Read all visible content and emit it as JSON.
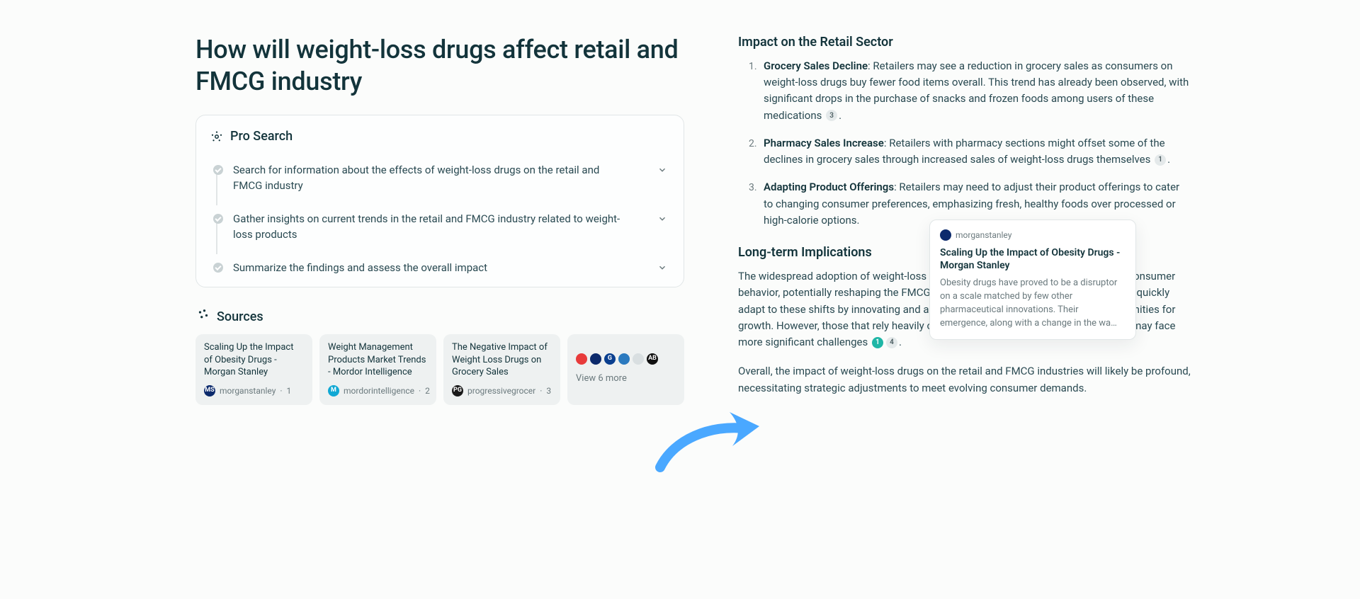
{
  "title": "How will weight-loss drugs affect retail and FMCG industry",
  "pro_search": {
    "label": "Pro Search",
    "steps": [
      {
        "text": "Search for information about the effects of weight-loss drugs on the retail and FMCG industry"
      },
      {
        "text": "Gather insights on current trends in the retail and FMCG industry related to weight-loss products"
      },
      {
        "text": "Summarize the findings and assess the overall impact"
      }
    ]
  },
  "sources": {
    "label": "Sources",
    "items": [
      {
        "title": "Scaling Up the Impact of Obesity Drugs - Morgan Stanley",
        "site": "morganstanley",
        "idx": "1",
        "fav_bg": "#0c2a6c",
        "fav_tx": "MS"
      },
      {
        "title": "Weight Management Products Market Trends - Mordor Intelligence",
        "site": "mordorintelligence",
        "idx": "2",
        "fav_bg": "#10a8d4",
        "fav_tx": "M"
      },
      {
        "title": "The Negative Impact of Weight Loss Drugs on Grocery Sales",
        "site": "progressivegrocer",
        "idx": "3",
        "fav_bg": "#1a1a1a",
        "fav_tx": "PG"
      }
    ],
    "more": {
      "label": "View 6 more",
      "favs": [
        {
          "bg": "#e83b3b",
          "tx": ""
        },
        {
          "bg": "#0c2a6c",
          "tx": ""
        },
        {
          "bg": "#0a3f8f",
          "tx": "G"
        },
        {
          "bg": "#2b7abf",
          "tx": ""
        },
        {
          "bg": "#d9dfe1",
          "tx": ""
        },
        {
          "bg": "#111",
          "tx": "AB"
        }
      ]
    }
  },
  "answer": {
    "retail_heading": "Impact on the Retail Sector",
    "retail_items": [
      {
        "bold": "Grocery Sales Decline",
        "text": ": Retailers may see a reduction in grocery sales as consumers on weight-loss drugs buy fewer food items overall. This trend has already been observed, with significant drops in the purchase of snacks and frozen foods among users of these medications ",
        "cite": "3",
        "tail": "."
      },
      {
        "bold": "Pharmacy Sales Increase",
        "text": ": Retailers with pharmacy sections might offset some of the declines in grocery sales through increased sales of weight-loss drugs themselves ",
        "cite": "1",
        "tail": "."
      },
      {
        "bold": "Adapting Product Offerings",
        "text": ": Retailers may need to adjust their product offerings to cater to changing consumer preferences, emphasizing fresh, healthy foods over processed or high-calorie options.",
        "cite": "",
        "tail": ""
      }
    ],
    "long_heading": "Long-term Implications",
    "long_para": "The widespread adoption of weight-loss drugs could lead to a fundamental shift in consumer behavior, potentially reshaping the FMCG and retail landscapes. Companies that can quickly adapt to these shifts by innovating and aligning their products may find new opportunities for growth. However, those that rely heavily on sales of high-calorie, indulgent products may face more significant challenges ",
    "long_cites": [
      "1",
      "4"
    ],
    "long_tail": ".",
    "closing": "Overall, the impact of weight-loss drugs on the retail and FMCG industries will likely be profound, necessitating strategic adjustments to meet evolving consumer demands."
  },
  "tooltip": {
    "site": "morganstanley",
    "title": "Scaling Up the Impact of Obesity Drugs - Morgan Stanley",
    "desc": "Obesity drugs have proved to be a disruptor on a scale matched by few other pharmaceutical innovations. Their emergence, along with a change in the wa…"
  }
}
